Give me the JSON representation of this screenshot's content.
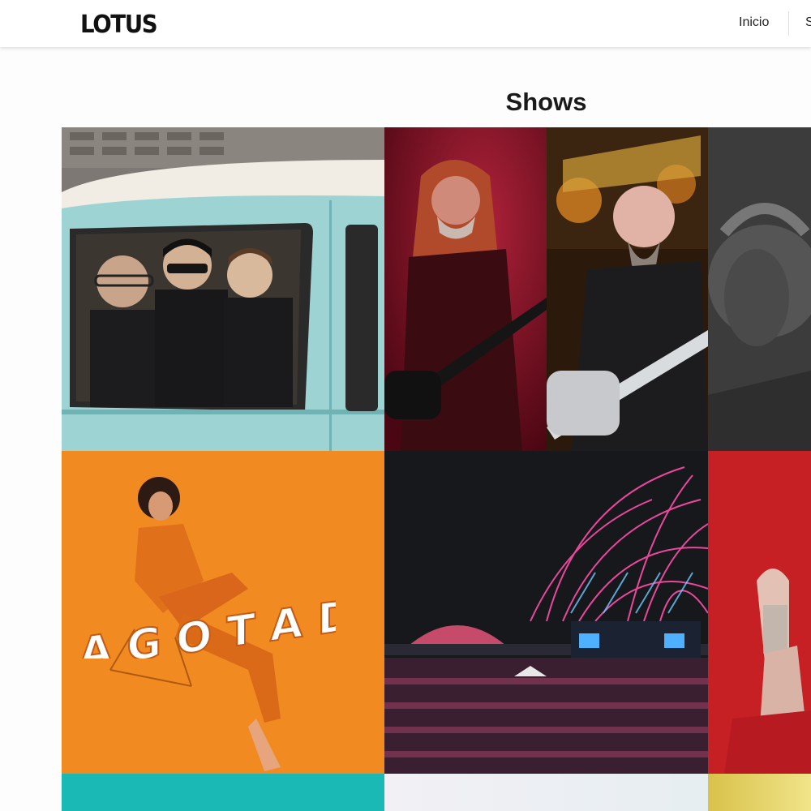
{
  "header": {
    "logo": "LOTUS",
    "nav": [
      {
        "label": "Inicio"
      },
      {
        "label": "S"
      }
    ]
  },
  "main": {
    "title": "Shows",
    "tiles": [
      {
        "name": "show-tile-band-car",
        "image": "three-men-in-vintage-car"
      },
      {
        "name": "show-tile-bassist",
        "image": "red-lit-bassist"
      },
      {
        "name": "show-tile-guitarist",
        "image": "anthrax-guitarist"
      },
      {
        "name": "show-tile-bw-artist",
        "image": "black-white-portrait"
      },
      {
        "name": "show-tile-agotado",
        "image": "orange-seated-artist",
        "overlay": "AGOTADO"
      },
      {
        "name": "show-tile-festival",
        "image": "festival-fireworks"
      },
      {
        "name": "show-tile-red-artist",
        "image": "red-tattooed-artist"
      },
      {
        "name": "show-tile-teal",
        "image": "teal"
      },
      {
        "name": "show-tile-pale",
        "image": "pale"
      },
      {
        "name": "show-tile-yellow",
        "image": "yellow"
      }
    ]
  },
  "colors": {
    "orange": "#f28a22",
    "teal": "#1ab9b5",
    "car": "#9ed3d4",
    "red": "#c72024"
  }
}
